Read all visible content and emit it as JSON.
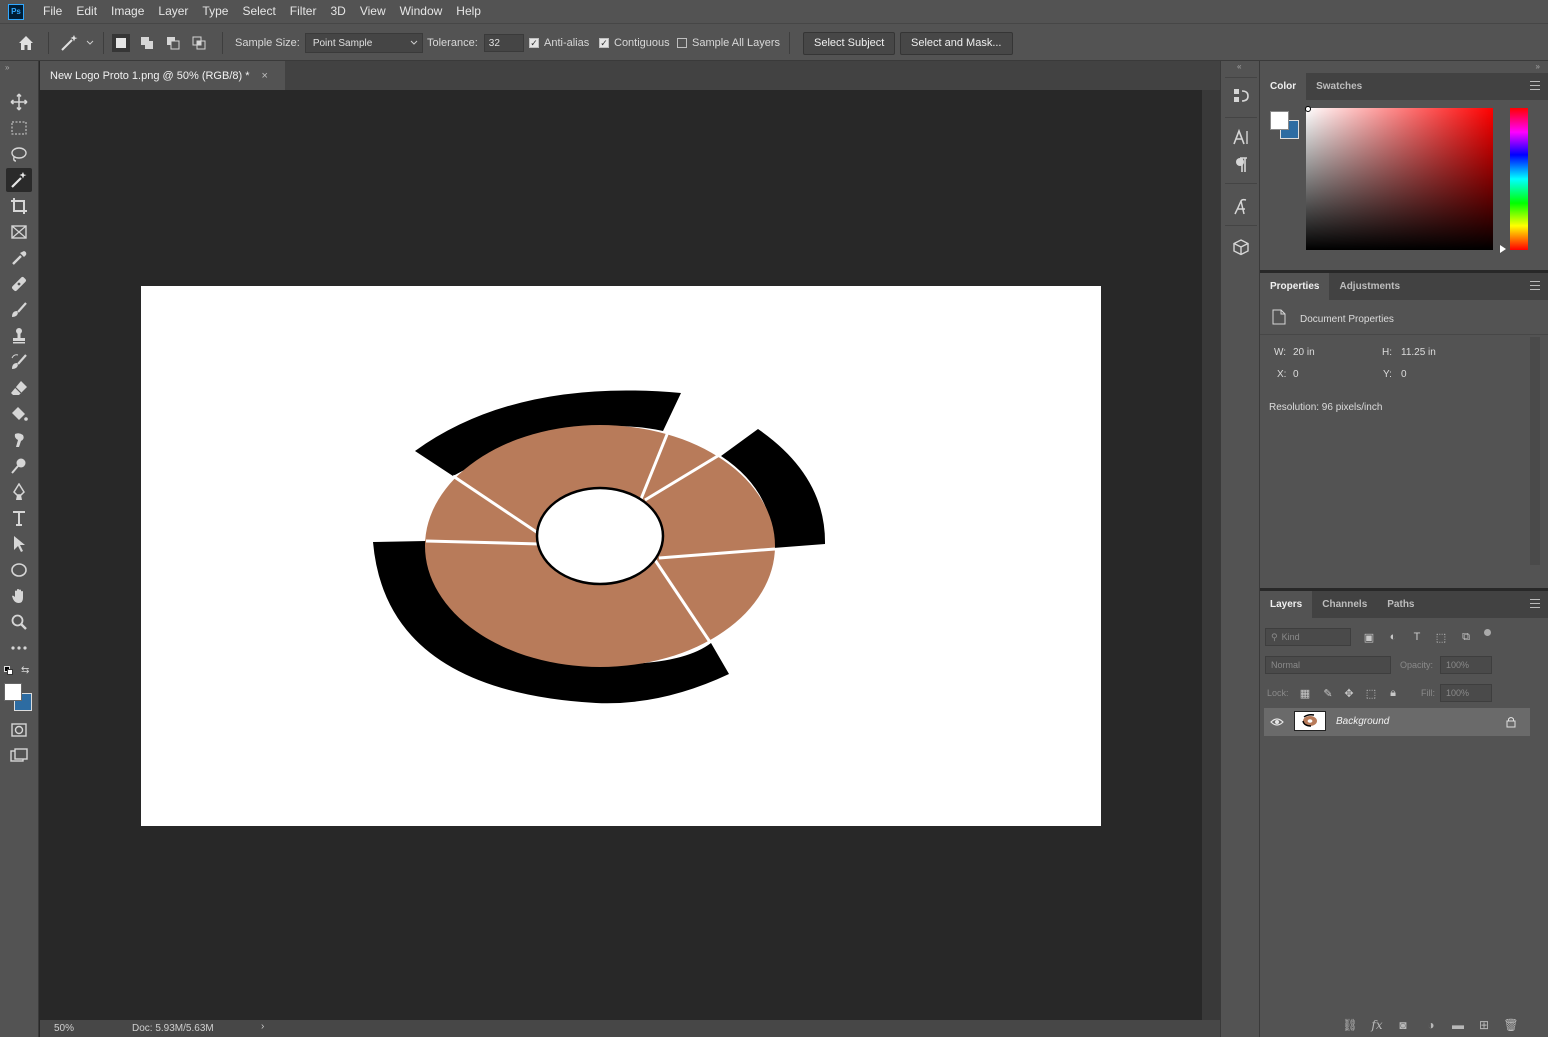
{
  "app": {
    "logo_text": "Ps"
  },
  "menu": [
    "File",
    "Edit",
    "Image",
    "Layer",
    "Type",
    "Select",
    "Filter",
    "3D",
    "View",
    "Window",
    "Help"
  ],
  "options": {
    "sample_size_label": "Sample Size:",
    "sample_size_value": "Point Sample",
    "tolerance_label": "Tolerance:",
    "tolerance_value": "32",
    "anti_alias_label": "Anti-alias",
    "anti_alias_checked": true,
    "contiguous_label": "Contiguous",
    "contiguous_checked": true,
    "sample_all_layers_label": "Sample All Layers",
    "sample_all_layers_checked": false,
    "select_subject_label": "Select Subject",
    "select_and_mask_label": "Select and Mask..."
  },
  "document": {
    "tab_title": "New Logo Proto 1.png @ 50% (RGB/8) *",
    "close_glyph": "×",
    "zoom": "50%",
    "doc_size": "Doc: 5.93M/5.63M"
  },
  "tools": [
    {
      "name": "move-tool-icon"
    },
    {
      "name": "marquee-tool-icon"
    },
    {
      "name": "lasso-tool-icon"
    },
    {
      "name": "magic-wand-tool-icon",
      "active": true
    },
    {
      "name": "crop-tool-icon"
    },
    {
      "name": "frame-tool-icon"
    },
    {
      "name": "eyedropper-tool-icon"
    },
    {
      "name": "healing-brush-tool-icon"
    },
    {
      "name": "brush-tool-icon"
    },
    {
      "name": "clone-stamp-tool-icon"
    },
    {
      "name": "history-brush-tool-icon"
    },
    {
      "name": "eraser-tool-icon"
    },
    {
      "name": "paint-bucket-tool-icon"
    },
    {
      "name": "smudge-tool-icon"
    },
    {
      "name": "dodge-tool-icon"
    },
    {
      "name": "pen-tool-icon"
    },
    {
      "name": "type-tool-icon"
    },
    {
      "name": "path-selection-tool-icon"
    },
    {
      "name": "ellipse-tool-icon"
    },
    {
      "name": "hand-tool-icon"
    },
    {
      "name": "zoom-tool-icon"
    },
    {
      "name": "more-tools-icon"
    }
  ],
  "colors": {
    "foreground": "#ffffff",
    "background": "#2d6ca2",
    "logo_fill": "#b87b5a",
    "logo_dark": "#000000",
    "panel_bg": "#535353",
    "canvas_bg": "#282828"
  },
  "color_panel": {
    "tabs": [
      "Color",
      "Swatches"
    ],
    "active_tab": "Color"
  },
  "properties_panel": {
    "tabs": [
      "Properties",
      "Adjustments"
    ],
    "active_tab": "Properties",
    "section_title": "Document Properties",
    "w_label": "W:",
    "w_value": "20 in",
    "h_label": "H:",
    "h_value": "11.25 in",
    "x_label": "X:",
    "x_value": "0",
    "y_label": "Y:",
    "y_value": "0",
    "resolution": "Resolution: 96 pixels/inch"
  },
  "layers_panel": {
    "tabs": [
      "Layers",
      "Channels",
      "Paths"
    ],
    "active_tab": "Layers",
    "kind_placeholder": "Kind",
    "blend_mode": "Normal",
    "opacity_label": "Opacity:",
    "opacity_value": "100%",
    "lock_label": "Lock:",
    "fill_label": "Fill:",
    "fill_value": "100%",
    "layers": [
      {
        "name": "Background",
        "visible": true,
        "locked": true
      }
    ]
  }
}
